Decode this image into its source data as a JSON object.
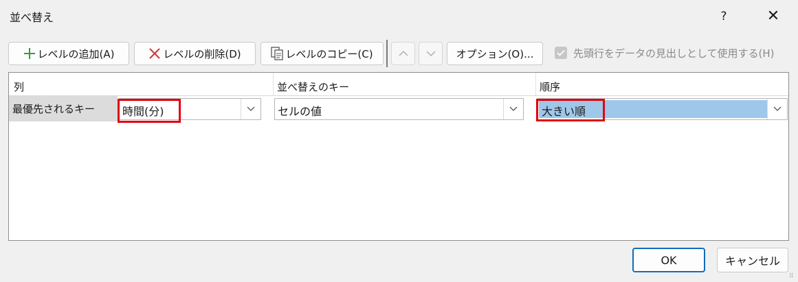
{
  "dialog": {
    "title": "並べ替え",
    "help": "?",
    "close": "✕"
  },
  "toolbar": {
    "add_level": "レベルの追加(A)",
    "delete_level": "レベルの削除(D)",
    "copy_level": "レベルのコピー(C)",
    "options": "オプション(O)...",
    "header_checkbox_label": "先頭行をデータの見出しとして使用する(H)",
    "header_checkbox_checked": true,
    "header_checkbox_enabled": false
  },
  "grid": {
    "headers": {
      "column": "列",
      "sort_on": "並べ替えのキー",
      "order": "順序"
    },
    "row": {
      "label": "最優先されるキー",
      "column_value": "時間(分)",
      "sort_on_value": "セルの値",
      "order_value": "大きい順"
    }
  },
  "footer": {
    "ok": "OK",
    "cancel": "キャンセル"
  },
  "colors": {
    "annotation_red": "#e0000b",
    "selection_blue": "#9fc7e9",
    "ok_border": "#0f6cbd",
    "add_green": "#2e9e3e",
    "delete_red": "#d13438"
  }
}
